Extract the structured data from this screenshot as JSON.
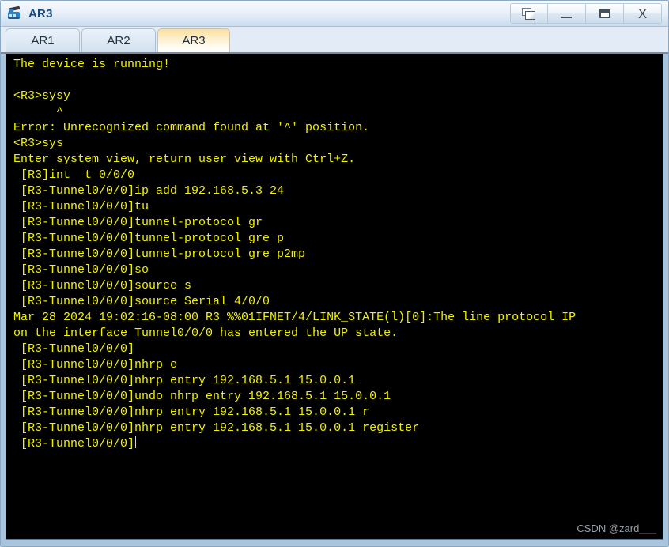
{
  "window": {
    "title": "AR3",
    "icon": "router-icon",
    "buttons": [
      {
        "name": "restore-button",
        "label": "",
        "icon": "restore-window-icon"
      },
      {
        "name": "minimize-button",
        "label": "",
        "icon": "minimize-icon"
      },
      {
        "name": "maximize-button",
        "label": "",
        "icon": "maximize-icon"
      },
      {
        "name": "close-button",
        "label": "X",
        "icon": "close-icon"
      }
    ]
  },
  "tabs": [
    {
      "label": "AR1",
      "active": false
    },
    {
      "label": "AR2",
      "active": false
    },
    {
      "label": "AR3",
      "active": true
    }
  ],
  "terminal": {
    "background_color": "#000000",
    "text_color": "#f2f200",
    "lines": [
      "The device is running!",
      "",
      "<R3>sysy",
      "      ^",
      "Error: Unrecognized command found at '^' position.",
      "<R3>sys",
      "Enter system view, return user view with Ctrl+Z.",
      " [R3]int  t 0/0/0",
      " [R3-Tunnel0/0/0]ip add 192.168.5.3 24",
      " [R3-Tunnel0/0/0]tu",
      " [R3-Tunnel0/0/0]tunnel-protocol gr",
      " [R3-Tunnel0/0/0]tunnel-protocol gre p",
      " [R3-Tunnel0/0/0]tunnel-protocol gre p2mp",
      " [R3-Tunnel0/0/0]so",
      " [R3-Tunnel0/0/0]source s",
      " [R3-Tunnel0/0/0]source Serial 4/0/0",
      "Mar 28 2024 19:02:16-08:00 R3 %%01IFNET/4/LINK_STATE(l)[0]:The line protocol IP",
      "on the interface Tunnel0/0/0 has entered the UP state.",
      " [R3-Tunnel0/0/0]",
      " [R3-Tunnel0/0/0]nhrp e",
      " [R3-Tunnel0/0/0]nhrp entry 192.168.5.1 15.0.0.1",
      " [R3-Tunnel0/0/0]undo nhrp entry 192.168.5.1 15.0.0.1",
      " [R3-Tunnel0/0/0]nhrp entry 192.168.5.1 15.0.0.1 r",
      " [R3-Tunnel0/0/0]nhrp entry 192.168.5.1 15.0.0.1 register"
    ],
    "prompt_line": " [R3-Tunnel0/0/0]",
    "watermark": "CSDN @zard___"
  }
}
